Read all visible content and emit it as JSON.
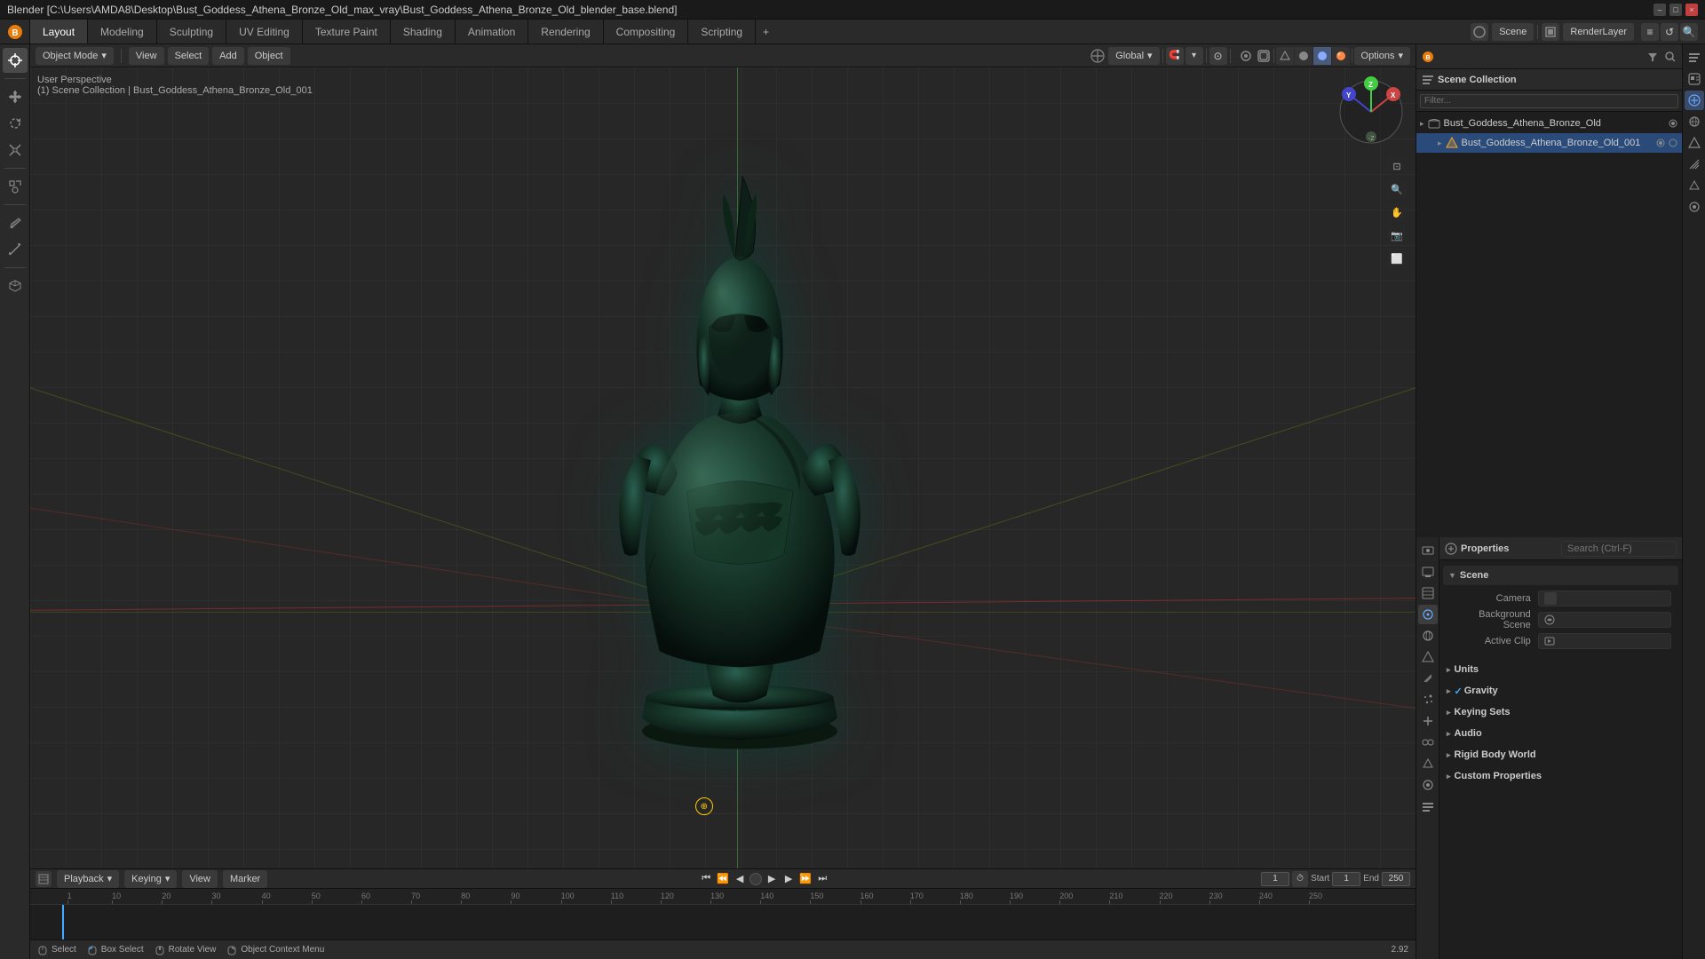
{
  "window": {
    "title": "Blender [C:\\Users\\AMDA8\\Desktop\\Bust_Goddess_Athena_Bronze_Old_max_vray\\Bust_Goddess_Athena_Bronze_Old_blender_base.blend]",
    "controls": [
      "–",
      "□",
      "×"
    ]
  },
  "tabs": [
    {
      "label": "Layout",
      "active": true
    },
    {
      "label": "Modeling",
      "active": false
    },
    {
      "label": "Sculpting",
      "active": false
    },
    {
      "label": "UV Editing",
      "active": false
    },
    {
      "label": "Texture Paint",
      "active": false
    },
    {
      "label": "Shading",
      "active": false
    },
    {
      "label": "Animation",
      "active": false
    },
    {
      "label": "Rendering",
      "active": false
    },
    {
      "label": "Compositing",
      "active": false
    },
    {
      "label": "Scripting",
      "active": false
    }
  ],
  "viewport_header": {
    "object_mode": "Object Mode",
    "view": "View",
    "select": "Select",
    "add": "Add",
    "object": "Object",
    "transform_global": "Global",
    "options": "Options"
  },
  "viewport_info": {
    "perspective": "User Perspective",
    "collection": "(1) Scene Collection | Bust_Goddess_Athena_Bronze_Old_001"
  },
  "outliner": {
    "title": "Scene Collection",
    "items": [
      {
        "name": "Bust_Goddess_Athena_Bronze_Old",
        "icon": "📁",
        "indent": 0,
        "expanded": true
      },
      {
        "name": "Bust_Goddess_Athena_Bronze_Old_001",
        "icon": "🔺",
        "indent": 1,
        "expanded": false,
        "selected": true
      }
    ]
  },
  "properties": {
    "search_placeholder": "Search (Ctrl-F)",
    "active_tab": "scene",
    "scene_section": {
      "label": "Scene",
      "camera_label": "Camera",
      "camera_value": "",
      "background_scene_label": "Background Scene",
      "background_scene_value": "",
      "active_clip_label": "Active Clip",
      "active_clip_value": ""
    },
    "sections": [
      {
        "label": "Units",
        "expanded": false
      },
      {
        "label": "Gravity",
        "expanded": false,
        "checked": true
      },
      {
        "label": "Keying Sets",
        "expanded": false
      },
      {
        "label": "Audio",
        "expanded": false
      },
      {
        "label": "Rigid Body World",
        "expanded": false
      },
      {
        "label": "Custom Properties",
        "expanded": false
      }
    ]
  },
  "timeline": {
    "playback": "Playback",
    "keying": "Keying",
    "view": "View",
    "marker": "Marker",
    "start": 1,
    "end": 250,
    "current_frame": 1,
    "ruler_marks": [
      1,
      10,
      20,
      30,
      40,
      50,
      60,
      70,
      80,
      90,
      100,
      110,
      120,
      130,
      140,
      150,
      160,
      170,
      180,
      190,
      200,
      210,
      220,
      230,
      240,
      250
    ]
  },
  "status_bar": {
    "select": "Select",
    "box_select": "Box Select",
    "rotate_view": "Rotate View",
    "object_context_menu": "Object Context Menu",
    "version": "2.92"
  },
  "top_right": {
    "scene_label": "Scene",
    "render_layer": "RenderLayer"
  },
  "props_icons": [
    {
      "name": "render",
      "symbol": "📷"
    },
    {
      "name": "output",
      "symbol": "🖨"
    },
    {
      "name": "view-layer",
      "symbol": "🔲"
    },
    {
      "name": "scene",
      "symbol": "🌐",
      "active": true
    },
    {
      "name": "world",
      "symbol": "🌍"
    },
    {
      "name": "object",
      "symbol": "🔺"
    },
    {
      "name": "modifier",
      "symbol": "🔧"
    },
    {
      "name": "particles",
      "symbol": "✦"
    },
    {
      "name": "physics",
      "symbol": "⚡"
    },
    {
      "name": "constraints",
      "symbol": "🔗"
    },
    {
      "name": "data",
      "symbol": "△"
    },
    {
      "name": "material",
      "symbol": "◉"
    },
    {
      "name": "shaderfx",
      "symbol": "☰"
    }
  ]
}
